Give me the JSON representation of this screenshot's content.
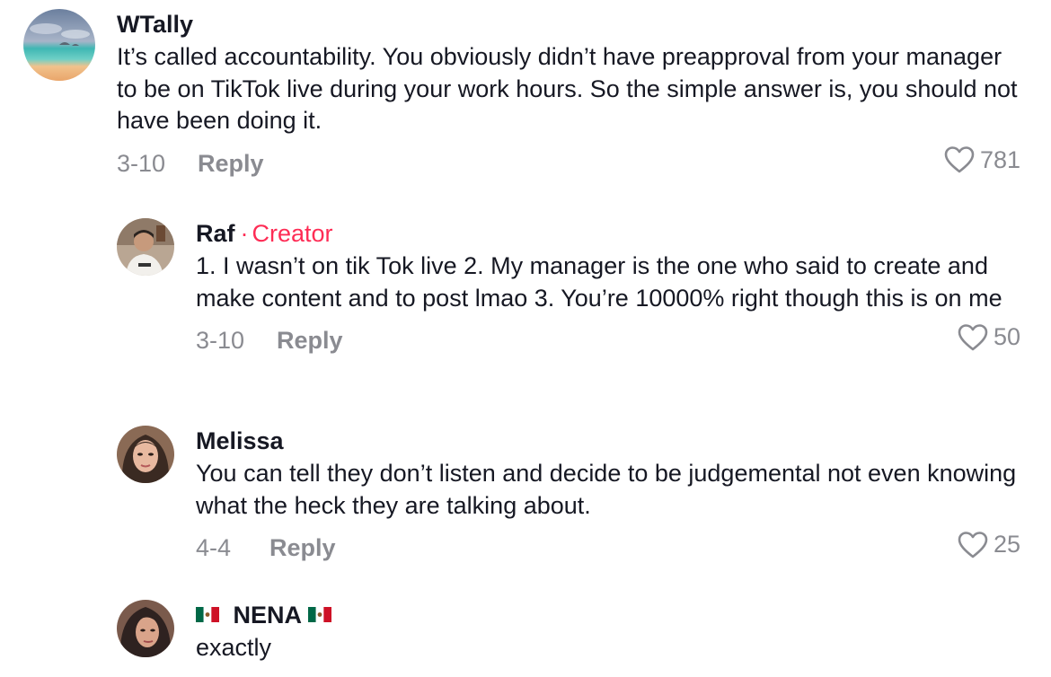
{
  "comments": [
    {
      "username": "WTally",
      "creator_tag": "",
      "text": "It’s called accountability. You obviously didn’t have preapproval from your manager to be on TikTok live during your work hours. So the simple answer is, you should not have been doing it.",
      "date": "3-10",
      "reply_label": "Reply",
      "likes": "781"
    },
    {
      "username": "Raf",
      "creator_separator": "·",
      "creator_tag": "Creator",
      "text": "1. I wasn’t on tik Tok live 2. My manager is the one who said to create and make content and to post lmao 3. You’re 10000% right though this is on me",
      "date": "3-10",
      "reply_label": "Reply",
      "likes": "50"
    },
    {
      "username": "Melissa",
      "creator_tag": "",
      "text": "You can tell they don’t listen and decide to be judgemental not even knowing what the heck they are talking about.",
      "date": "4-4",
      "reply_label": "Reply",
      "likes": "25"
    },
    {
      "username": "NENA",
      "creator_tag": "",
      "text": "exactly"
    }
  ],
  "colors": {
    "creator": "#fe2c55",
    "muted": "#8a8b91",
    "text": "#161823"
  },
  "icons": {
    "like": "heart-outline-icon",
    "flag": "mexico-flag-icon"
  }
}
